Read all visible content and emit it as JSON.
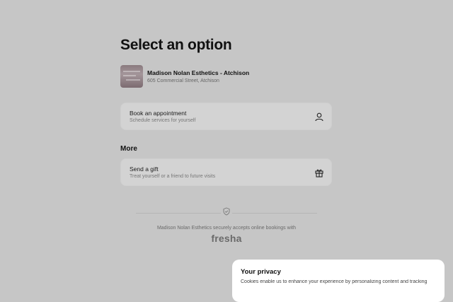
{
  "page": {
    "title": "Select an option"
  },
  "venue": {
    "name": "Madison Nolan Esthetics - Atchison",
    "address": "605 Commercial Street, Atchison",
    "thumbnail_icon": "venue-photo"
  },
  "options": [
    {
      "title": "Book an appointment",
      "subtitle": "Schedule services for yourself",
      "icon": "user-icon"
    }
  ],
  "more": {
    "heading": "More",
    "items": [
      {
        "title": "Send a gift",
        "subtitle": "Treat yourself or a friend to future visits",
        "icon": "gift-icon"
      }
    ]
  },
  "footer": {
    "text": "Madison Nolan Esthetics securely accepts online bookings with",
    "brand": "fresha",
    "icon": "shield-check-icon"
  },
  "privacy": {
    "title": "Your privacy",
    "body": "Cookies enable us to enhance your experience by personalizing content and tracking"
  },
  "colors": {
    "overlay": "#c6c6c6",
    "card": "#d3d3d3",
    "dialog": "#ffffff"
  }
}
